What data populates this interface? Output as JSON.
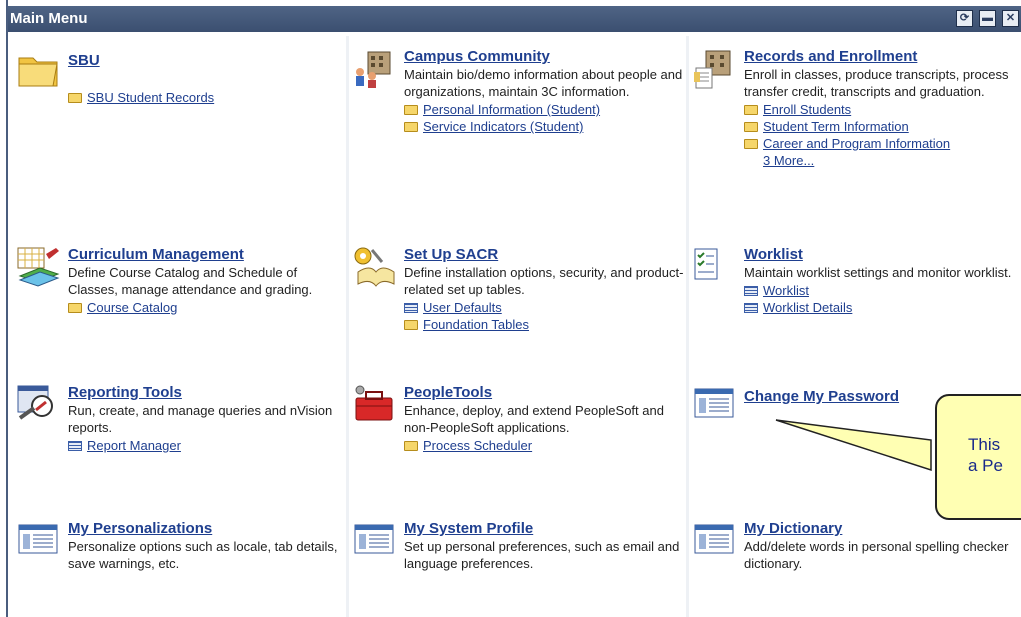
{
  "window": {
    "title": "Main Menu",
    "buttons": [
      {
        "name": "refresh-icon",
        "glyph": "⟳"
      },
      {
        "name": "minimize-icon",
        "glyph": "▬"
      },
      {
        "name": "close-icon",
        "glyph": "✕"
      }
    ]
  },
  "tiles": [
    {
      "id": "sbu",
      "icon": "folder-icon",
      "title": "SBU",
      "desc": "",
      "links": [
        {
          "label": "SBU Student Records",
          "icon": "folder-small-icon"
        }
      ]
    },
    {
      "id": "campus-community",
      "icon": "people-buildings-icon",
      "title": "Campus Community",
      "desc": "Maintain bio/demo information about people and organizations, maintain 3C information.",
      "links": [
        {
          "label": "Personal Information (Student)",
          "icon": "folder-small-icon"
        },
        {
          "label": "Service Indicators (Student)",
          "icon": "folder-small-icon"
        }
      ]
    },
    {
      "id": "records-enrollment",
      "icon": "records-buildings-icon",
      "title": "Records and Enrollment",
      "desc": "Enroll in classes, produce transcripts, process transfer credit, transcripts and graduation.",
      "links": [
        {
          "label": "Enroll Students",
          "icon": "folder-small-icon"
        },
        {
          "label": "Student Term Information",
          "icon": "folder-small-icon"
        },
        {
          "label": "Career and Program Information",
          "icon": "folder-small-icon"
        }
      ],
      "more": "3 More..."
    },
    {
      "id": "curriculum-management",
      "icon": "curriculum-books-icon",
      "title": "Curriculum Management",
      "desc": "Define Course Catalog and Schedule of Classes, manage attendance and grading.",
      "links": [
        {
          "label": "Course Catalog",
          "icon": "folder-small-icon"
        }
      ]
    },
    {
      "id": "set-up-sacr",
      "icon": "setup-book-icon",
      "title": "Set Up SACR",
      "desc": "Define installation options, security, and product-related set up tables.",
      "links": [
        {
          "label": "User Defaults",
          "icon": "list-small-icon"
        },
        {
          "label": "Foundation Tables",
          "icon": "folder-small-icon"
        }
      ]
    },
    {
      "id": "worklist",
      "icon": "worklist-icon",
      "title": "Worklist",
      "desc": "Maintain worklist settings and monitor worklist.",
      "links": [
        {
          "label": "Worklist",
          "icon": "list-small-icon"
        },
        {
          "label": "Worklist Details",
          "icon": "list-small-icon"
        }
      ]
    },
    {
      "id": "reporting-tools",
      "icon": "reporting-tools-icon",
      "title": "Reporting Tools",
      "desc": "Run, create, and manage queries and nVision reports.",
      "links": [
        {
          "label": "Report Manager",
          "icon": "list-small-icon"
        }
      ]
    },
    {
      "id": "peopletools",
      "icon": "toolbox-icon",
      "title": "PeopleTools",
      "desc": "Enhance, deploy, and extend PeopleSoft and non-PeopleSoft applications.",
      "links": [
        {
          "label": "Process Scheduler",
          "icon": "folder-small-icon"
        }
      ]
    },
    {
      "id": "change-password",
      "icon": "window-list-icon",
      "title": "Change My Password",
      "desc": "",
      "links": []
    },
    {
      "id": "my-personalizations",
      "icon": "window-list-icon",
      "title": "My Personalizations",
      "desc": "Personalize options such as locale, tab details, save warnings, etc.",
      "links": []
    },
    {
      "id": "my-system-profile",
      "icon": "window-list-icon",
      "title": "My System Profile",
      "desc": "Set up personal preferences, such as email and language preferences.",
      "links": []
    },
    {
      "id": "my-dictionary",
      "icon": "window-list-icon",
      "title": "My Dictionary",
      "desc": "Add/delete words in personal spelling checker dictionary.",
      "links": []
    }
  ],
  "callout": {
    "line1": "This",
    "line2": "a Pe"
  },
  "colors": {
    "titlebar": "#3b4f70",
    "link": "#1f3f8f",
    "callout_bg": "#ffffb3"
  }
}
